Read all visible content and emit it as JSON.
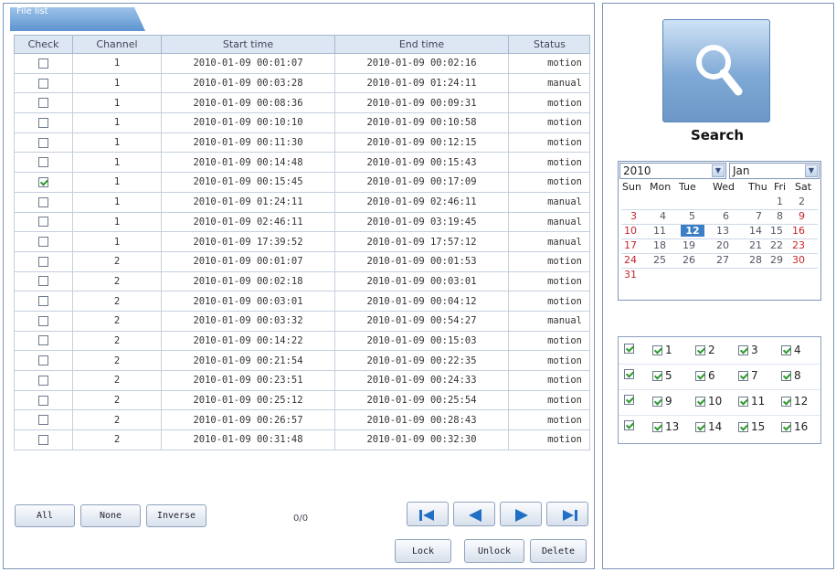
{
  "file_list": {
    "tab_label": "File list",
    "columns": [
      "Check",
      "Channel",
      "Start time",
      "End time",
      "Status"
    ],
    "rows": [
      {
        "checked": false,
        "channel": "1",
        "start": "2010-01-09 00:01:07",
        "end": "2010-01-09 00:02:16",
        "status": "motion"
      },
      {
        "checked": false,
        "channel": "1",
        "start": "2010-01-09 00:03:28",
        "end": "2010-01-09 01:24:11",
        "status": "manual"
      },
      {
        "checked": false,
        "channel": "1",
        "start": "2010-01-09 00:08:36",
        "end": "2010-01-09 00:09:31",
        "status": "motion"
      },
      {
        "checked": false,
        "channel": "1",
        "start": "2010-01-09 00:10:10",
        "end": "2010-01-09 00:10:58",
        "status": "motion"
      },
      {
        "checked": false,
        "channel": "1",
        "start": "2010-01-09 00:11:30",
        "end": "2010-01-09 00:12:15",
        "status": "motion"
      },
      {
        "checked": false,
        "channel": "1",
        "start": "2010-01-09 00:14:48",
        "end": "2010-01-09 00:15:43",
        "status": "motion"
      },
      {
        "checked": true,
        "channel": "1",
        "start": "2010-01-09 00:15:45",
        "end": "2010-01-09 00:17:09",
        "status": "motion"
      },
      {
        "checked": false,
        "channel": "1",
        "start": "2010-01-09 01:24:11",
        "end": "2010-01-09 02:46:11",
        "status": "manual"
      },
      {
        "checked": false,
        "channel": "1",
        "start": "2010-01-09 02:46:11",
        "end": "2010-01-09 03:19:45",
        "status": "manual"
      },
      {
        "checked": false,
        "channel": "1",
        "start": "2010-01-09 17:39:52",
        "end": "2010-01-09 17:57:12",
        "status": "manual"
      },
      {
        "checked": false,
        "channel": "2",
        "start": "2010-01-09 00:01:07",
        "end": "2010-01-09 00:01:53",
        "status": "motion"
      },
      {
        "checked": false,
        "channel": "2",
        "start": "2010-01-09 00:02:18",
        "end": "2010-01-09 00:03:01",
        "status": "motion"
      },
      {
        "checked": false,
        "channel": "2",
        "start": "2010-01-09 00:03:01",
        "end": "2010-01-09 00:04:12",
        "status": "motion"
      },
      {
        "checked": false,
        "channel": "2",
        "start": "2010-01-09 00:03:32",
        "end": "2010-01-09 00:54:27",
        "status": "manual"
      },
      {
        "checked": false,
        "channel": "2",
        "start": "2010-01-09 00:14:22",
        "end": "2010-01-09 00:15:03",
        "status": "motion"
      },
      {
        "checked": false,
        "channel": "2",
        "start": "2010-01-09 00:21:54",
        "end": "2010-01-09 00:22:35",
        "status": "motion"
      },
      {
        "checked": false,
        "channel": "2",
        "start": "2010-01-09 00:23:51",
        "end": "2010-01-09 00:24:33",
        "status": "motion"
      },
      {
        "checked": false,
        "channel": "2",
        "start": "2010-01-09 00:25:12",
        "end": "2010-01-09 00:25:54",
        "status": "motion"
      },
      {
        "checked": false,
        "channel": "2",
        "start": "2010-01-09 00:26:57",
        "end": "2010-01-09 00:28:43",
        "status": "motion"
      },
      {
        "checked": false,
        "channel": "2",
        "start": "2010-01-09 00:31:48",
        "end": "2010-01-09 00:32:30",
        "status": "motion"
      }
    ]
  },
  "selection": {
    "all_label": "All",
    "none_label": "None",
    "inverse_label": "Inverse",
    "count": "0/0"
  },
  "pager": {
    "first_icon": "first-page-icon",
    "prev_icon": "prev-page-icon",
    "next_icon": "next-page-icon",
    "last_icon": "last-page-icon"
  },
  "actions": {
    "lock_label": "Lock",
    "unlock_label": "Unlock",
    "delete_label": "Delete"
  },
  "search": {
    "label": "Search",
    "icon": "magnifier-icon"
  },
  "calendar": {
    "year": "2010",
    "month": "Jan",
    "weekdays": [
      "Sun",
      "Mon",
      "Tue",
      "Wed",
      "Thu",
      "Fri",
      "Sat"
    ],
    "days": [
      "1",
      "2",
      "3",
      "4",
      "5",
      "6",
      "7",
      "8",
      "9",
      "10",
      "11",
      "12",
      "13",
      "14",
      "15",
      "16",
      "17",
      "18",
      "19",
      "20",
      "21",
      "22",
      "23",
      "24",
      "25",
      "26",
      "27",
      "28",
      "29",
      "30",
      "31"
    ],
    "first_weekday": "Fri",
    "selected_day": "12",
    "highlighted_days": [
      "3",
      "9",
      "10",
      "16",
      "17",
      "23",
      "24",
      "30",
      "31"
    ]
  },
  "channels": {
    "rows": [
      {
        "all_checked": true,
        "items": [
          {
            "label": "1",
            "checked": true
          },
          {
            "label": "2",
            "checked": true
          },
          {
            "label": "3",
            "checked": true
          },
          {
            "label": "4",
            "checked": true
          }
        ]
      },
      {
        "all_checked": true,
        "items": [
          {
            "label": "5",
            "checked": true
          },
          {
            "label": "6",
            "checked": true
          },
          {
            "label": "7",
            "checked": true
          },
          {
            "label": "8",
            "checked": true
          }
        ]
      },
      {
        "all_checked": true,
        "items": [
          {
            "label": "9",
            "checked": true
          },
          {
            "label": "10",
            "checked": true
          },
          {
            "label": "11",
            "checked": true
          },
          {
            "label": "12",
            "checked": true
          }
        ]
      },
      {
        "all_checked": true,
        "items": [
          {
            "label": "13",
            "checked": true
          },
          {
            "label": "14",
            "checked": true
          },
          {
            "label": "15",
            "checked": true
          },
          {
            "label": "16",
            "checked": true
          }
        ]
      }
    ]
  },
  "colors": {
    "accent": "#3c7fc6",
    "weekend_red": "#c8262b",
    "border": "#7b93b5",
    "header_bg": "#dde7f4"
  }
}
